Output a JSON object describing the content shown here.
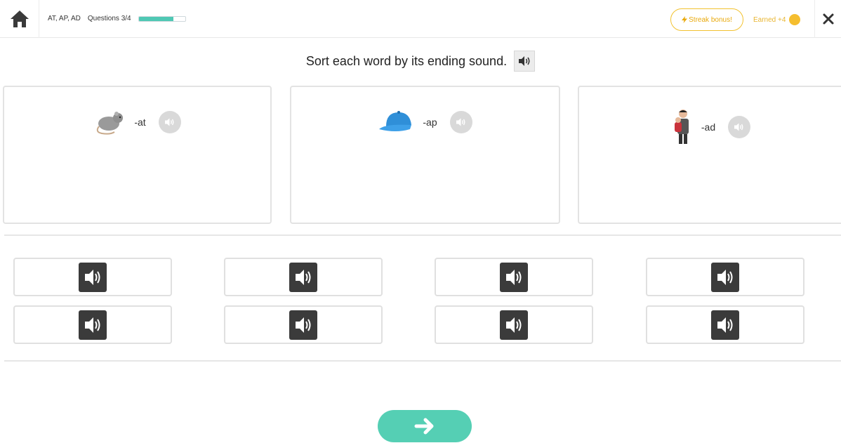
{
  "header": {
    "lesson": "AT, AP, AD",
    "questions_label": "Questions",
    "questions_count": "3/4",
    "progress_fraction": 0.75,
    "streak_label": "Streak bonus!",
    "earned_label": "Earned +4",
    "home_icon": "home-icon",
    "close_icon": "close-icon"
  },
  "instruction": {
    "text": "Sort each word by its ending sound."
  },
  "bins": [
    {
      "label": "-at",
      "picture": "rat-picture"
    },
    {
      "label": "-ap",
      "picture": "cap-picture"
    },
    {
      "label": "-ad",
      "picture": "dad-picture"
    }
  ],
  "cards": [
    {
      "icon": "speaker-icon"
    },
    {
      "icon": "speaker-icon"
    },
    {
      "icon": "speaker-icon"
    },
    {
      "icon": "speaker-icon"
    },
    {
      "icon": "speaker-icon"
    },
    {
      "icon": "speaker-icon"
    },
    {
      "icon": "speaker-icon"
    },
    {
      "icon": "speaker-icon"
    }
  ],
  "next_button": {
    "icon": "arrow-right-icon"
  },
  "colors": {
    "accent": "#55cfb4",
    "streak": "#f2c230",
    "coin": "#f5be2f"
  }
}
